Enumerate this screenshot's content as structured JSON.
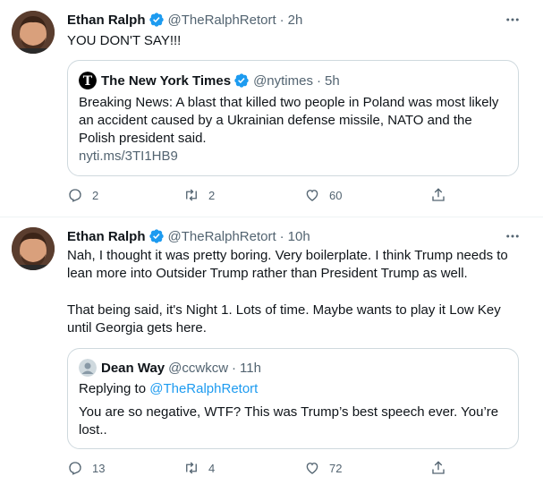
{
  "tweets": [
    {
      "author": "Ethan Ralph",
      "handle": "@TheRalphRetort",
      "time": "2h",
      "text": "YOU DON'T SAY!!!",
      "quote": {
        "author": "The New York Times",
        "handle": "@nytimes",
        "time": "5h",
        "text": "Breaking News: A blast that killed two people in Poland was most likely an accident caused by a Ukrainian defense missile, NATO and the Polish president said.",
        "link": "nyti.ms/3TI1HB9"
      },
      "replies": "2",
      "retweets": "2",
      "likes": "60"
    },
    {
      "author": "Ethan Ralph",
      "handle": "@TheRalphRetort",
      "time": "10h",
      "text_p1": "Nah, I thought it was pretty boring. Very boilerplate. I think Trump needs to lean more into Outsider Trump rather than President Trump as well.",
      "text_p2": "That being said, it's Night 1. Lots of time. Maybe wants to play it Low Key until Georgia gets here.",
      "quote": {
        "author": "Dean Way",
        "handle": "@ccwkcw",
        "time": "11h",
        "replying_prefix": "Replying to ",
        "replying_to": "@TheRalphRetort",
        "text": "You are so negative, WTF? This was Trump’s best speech ever. You’re lost.."
      },
      "replies": "13",
      "retweets": "4",
      "likes": "72"
    }
  ],
  "dot": "·",
  "icons": {
    "verified": "verified-badge-icon",
    "more": "more-dots-icon",
    "reply": "reply-icon",
    "retweet": "retweet-icon",
    "like": "heart-icon",
    "share": "share-icon"
  },
  "colors": {
    "verified": "#1d9bf0",
    "muted": "#536471",
    "border": "#cfd9de"
  }
}
